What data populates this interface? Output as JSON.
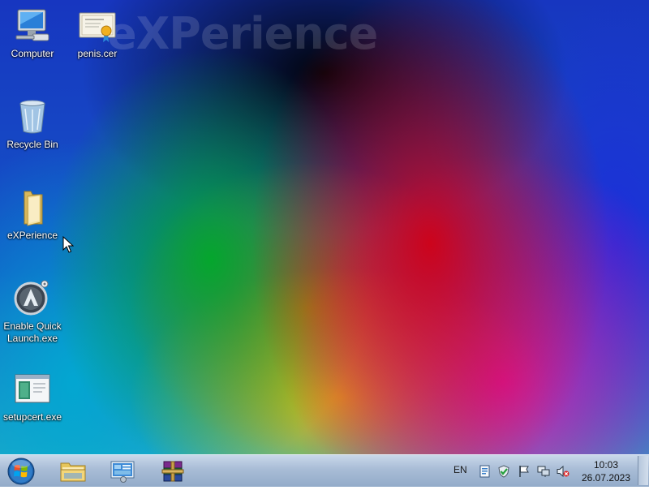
{
  "watermark": "eXPerience",
  "desktop_icons": [
    {
      "label": "Computer",
      "icon": "computer-icon"
    },
    {
      "label": "penis.cer",
      "icon": "certificate-icon"
    },
    {
      "label": "Recycle Bin",
      "icon": "recycle-bin-icon"
    },
    {
      "label": "eXPerience",
      "icon": "folder-icon"
    },
    {
      "label": "Enable Quick Launch.exe",
      "icon": "quick-launch-icon"
    },
    {
      "label": "setupcert.exe",
      "icon": "setup-window-icon"
    }
  ],
  "taskbar": {
    "start": "windows-orb-icon",
    "pinned": [
      "explorer-folder-icon",
      "control-panel-icon",
      "winrar-icon"
    ],
    "language": "EN",
    "tray_icons": [
      "document-icon",
      "shield-check-icon",
      "flag-icon",
      "network-icon",
      "speaker-muted-icon"
    ],
    "time": "10:03",
    "date": "26.07.2023"
  },
  "colors": {
    "taskbar": "#a8bcd6",
    "label_text": "#ffffff"
  }
}
